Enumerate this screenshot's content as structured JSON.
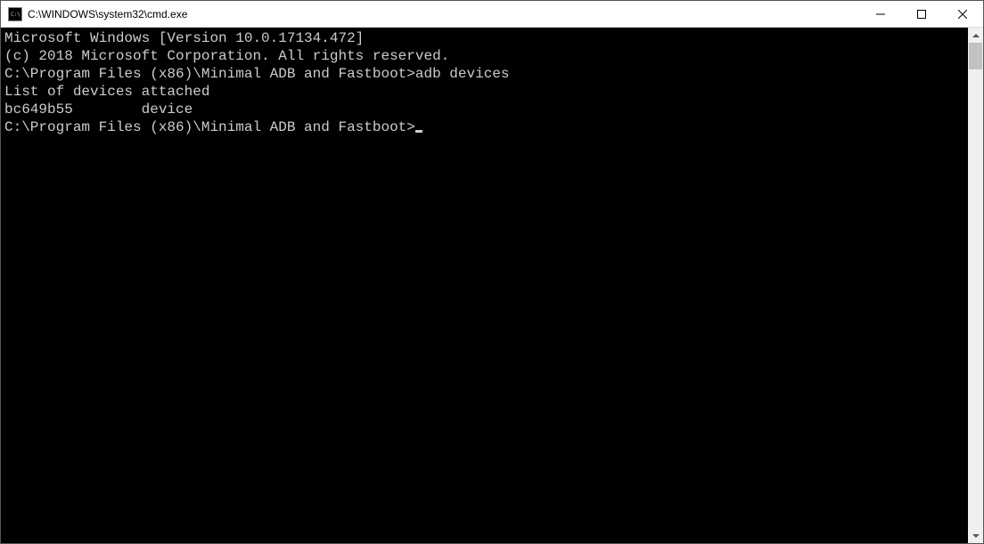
{
  "window": {
    "title": "C:\\WINDOWS\\system32\\cmd.exe"
  },
  "terminal": {
    "line1": "Microsoft Windows [Version 10.0.17134.472]",
    "line2": "(c) 2018 Microsoft Corporation. All rights reserved.",
    "blank1": "",
    "prompt1_path": "C:\\Program Files (x86)\\Minimal ADB and Fastboot>",
    "prompt1_cmd": "adb devices",
    "output_header": "List of devices attached",
    "output_row": "bc649b55        device",
    "blank2": "",
    "blank3": "",
    "prompt2_path": "C:\\Program Files (x86)\\Minimal ADB and Fastboot>"
  }
}
